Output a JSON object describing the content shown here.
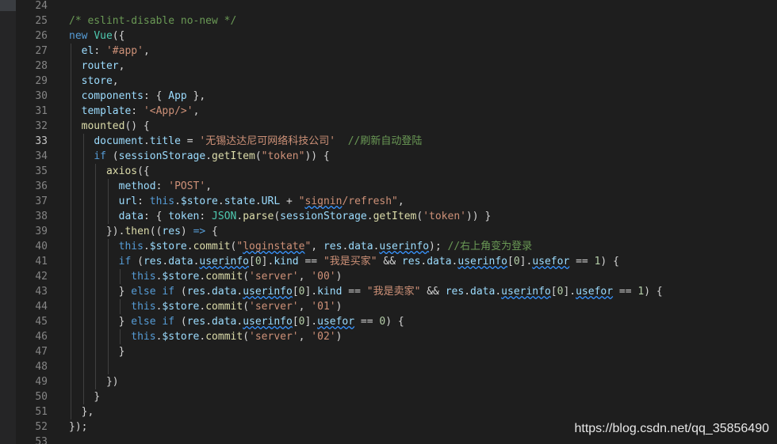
{
  "editor": {
    "lines": [
      {
        "num": "24",
        "tokens": []
      },
      {
        "num": "25",
        "tokens": [
          {
            "t": "/* eslint-disable no-new */",
            "c": "c"
          }
        ]
      },
      {
        "num": "26",
        "tokens": [
          {
            "t": "new ",
            "c": "k"
          },
          {
            "t": "Vue",
            "c": "t"
          },
          {
            "t": "({",
            "c": ""
          }
        ]
      },
      {
        "num": "27",
        "indent": 1,
        "tokens": [
          {
            "t": "el",
            "c": "p"
          },
          {
            "t": ": ",
            "c": ""
          },
          {
            "t": "'#app'",
            "c": "s"
          },
          {
            "t": ",",
            "c": ""
          }
        ]
      },
      {
        "num": "28",
        "indent": 1,
        "tokens": [
          {
            "t": "router",
            "c": "p"
          },
          {
            "t": ",",
            "c": ""
          }
        ]
      },
      {
        "num": "29",
        "indent": 1,
        "tokens": [
          {
            "t": "store",
            "c": "p"
          },
          {
            "t": ",",
            "c": ""
          }
        ]
      },
      {
        "num": "30",
        "indent": 1,
        "tokens": [
          {
            "t": "components",
            "c": "p"
          },
          {
            "t": ": { ",
            "c": ""
          },
          {
            "t": "App",
            "c": "p"
          },
          {
            "t": " },",
            "c": ""
          }
        ]
      },
      {
        "num": "31",
        "indent": 1,
        "tokens": [
          {
            "t": "template",
            "c": "p"
          },
          {
            "t": ": ",
            "c": ""
          },
          {
            "t": "'<App/>'",
            "c": "s"
          },
          {
            "t": ",",
            "c": ""
          }
        ]
      },
      {
        "num": "32",
        "indent": 1,
        "tokens": [
          {
            "t": "mounted",
            "c": "f"
          },
          {
            "t": "() {",
            "c": ""
          }
        ]
      },
      {
        "num": "33",
        "indent": 2,
        "active": true,
        "tokens": [
          {
            "t": "document",
            "c": "p"
          },
          {
            "t": ".",
            "c": ""
          },
          {
            "t": "title",
            "c": "p"
          },
          {
            "t": " = ",
            "c": ""
          },
          {
            "t": "'无锡达达尼可网络科技公司'",
            "c": "s"
          },
          {
            "t": "  ",
            "c": ""
          },
          {
            "t": "//刷新自动登陆",
            "c": "c"
          }
        ]
      },
      {
        "num": "34",
        "indent": 2,
        "tokens": [
          {
            "t": "if",
            "c": "k"
          },
          {
            "t": " (",
            "c": ""
          },
          {
            "t": "sessionStorage",
            "c": "p"
          },
          {
            "t": ".",
            "c": ""
          },
          {
            "t": "getItem",
            "c": "f"
          },
          {
            "t": "(",
            "c": ""
          },
          {
            "t": "\"token\"",
            "c": "s"
          },
          {
            "t": ")) {",
            "c": ""
          }
        ]
      },
      {
        "num": "35",
        "indent": 3,
        "tokens": [
          {
            "t": "axios",
            "c": "f"
          },
          {
            "t": "({",
            "c": ""
          }
        ]
      },
      {
        "num": "36",
        "indent": 4,
        "tokens": [
          {
            "t": "method",
            "c": "p"
          },
          {
            "t": ": ",
            "c": ""
          },
          {
            "t": "'POST'",
            "c": "s"
          },
          {
            "t": ",",
            "c": ""
          }
        ]
      },
      {
        "num": "37",
        "indent": 4,
        "tokens": [
          {
            "t": "url",
            "c": "p"
          },
          {
            "t": ": ",
            "c": ""
          },
          {
            "t": "this",
            "c": "k"
          },
          {
            "t": ".",
            "c": ""
          },
          {
            "t": "$store",
            "c": "p"
          },
          {
            "t": ".",
            "c": ""
          },
          {
            "t": "state",
            "c": "p"
          },
          {
            "t": ".",
            "c": ""
          },
          {
            "t": "URL",
            "c": "p"
          },
          {
            "t": " + ",
            "c": ""
          },
          {
            "t": "\"",
            "c": "s"
          },
          {
            "t": "signin",
            "c": "s",
            "sq": true
          },
          {
            "t": "/refresh\"",
            "c": "s"
          },
          {
            "t": ",",
            "c": ""
          }
        ]
      },
      {
        "num": "38",
        "indent": 4,
        "tokens": [
          {
            "t": "data",
            "c": "p"
          },
          {
            "t": ": { ",
            "c": ""
          },
          {
            "t": "token",
            "c": "p"
          },
          {
            "t": ": ",
            "c": ""
          },
          {
            "t": "JSON",
            "c": "t"
          },
          {
            "t": ".",
            "c": ""
          },
          {
            "t": "parse",
            "c": "f"
          },
          {
            "t": "(",
            "c": ""
          },
          {
            "t": "sessionStorage",
            "c": "p"
          },
          {
            "t": ".",
            "c": ""
          },
          {
            "t": "getItem",
            "c": "f"
          },
          {
            "t": "(",
            "c": ""
          },
          {
            "t": "'token'",
            "c": "s"
          },
          {
            "t": ")) }",
            "c": ""
          }
        ]
      },
      {
        "num": "39",
        "indent": 3,
        "tokens": [
          {
            "t": "}).",
            "c": ""
          },
          {
            "t": "then",
            "c": "f"
          },
          {
            "t": "((",
            "c": ""
          },
          {
            "t": "res",
            "c": "p"
          },
          {
            "t": ") ",
            "c": ""
          },
          {
            "t": "=>",
            "c": "k"
          },
          {
            "t": " {",
            "c": ""
          }
        ]
      },
      {
        "num": "40",
        "indent": 4,
        "tokens": [
          {
            "t": "this",
            "c": "k"
          },
          {
            "t": ".",
            "c": ""
          },
          {
            "t": "$store",
            "c": "p"
          },
          {
            "t": ".",
            "c": ""
          },
          {
            "t": "commit",
            "c": "f"
          },
          {
            "t": "(",
            "c": ""
          },
          {
            "t": "\"",
            "c": "s"
          },
          {
            "t": "loginstate",
            "c": "s",
            "sq": true
          },
          {
            "t": "\"",
            "c": "s"
          },
          {
            "t": ", ",
            "c": ""
          },
          {
            "t": "res",
            "c": "p"
          },
          {
            "t": ".",
            "c": ""
          },
          {
            "t": "data",
            "c": "p"
          },
          {
            "t": ".",
            "c": ""
          },
          {
            "t": "userinfo",
            "c": "p",
            "sq": true
          },
          {
            "t": "); ",
            "c": ""
          },
          {
            "t": "//右上角变为登录",
            "c": "c"
          }
        ]
      },
      {
        "num": "41",
        "indent": 4,
        "tokens": [
          {
            "t": "if",
            "c": "k"
          },
          {
            "t": " (",
            "c": ""
          },
          {
            "t": "res",
            "c": "p"
          },
          {
            "t": ".",
            "c": ""
          },
          {
            "t": "data",
            "c": "p"
          },
          {
            "t": ".",
            "c": ""
          },
          {
            "t": "userinfo",
            "c": "p",
            "sq": true
          },
          {
            "t": "[",
            "c": ""
          },
          {
            "t": "0",
            "c": "n"
          },
          {
            "t": "].",
            "c": ""
          },
          {
            "t": "kind",
            "c": "p"
          },
          {
            "t": " == ",
            "c": ""
          },
          {
            "t": "\"我是买家\"",
            "c": "s"
          },
          {
            "t": " && ",
            "c": ""
          },
          {
            "t": "res",
            "c": "p"
          },
          {
            "t": ".",
            "c": ""
          },
          {
            "t": "data",
            "c": "p"
          },
          {
            "t": ".",
            "c": ""
          },
          {
            "t": "userinfo",
            "c": "p",
            "sq": true
          },
          {
            "t": "[",
            "c": ""
          },
          {
            "t": "0",
            "c": "n"
          },
          {
            "t": "].",
            "c": ""
          },
          {
            "t": "usefor",
            "c": "p",
            "sq": true
          },
          {
            "t": " == ",
            "c": ""
          },
          {
            "t": "1",
            "c": "n"
          },
          {
            "t": ") {",
            "c": ""
          }
        ]
      },
      {
        "num": "42",
        "indent": 5,
        "tokens": [
          {
            "t": "this",
            "c": "k"
          },
          {
            "t": ".",
            "c": ""
          },
          {
            "t": "$store",
            "c": "p"
          },
          {
            "t": ".",
            "c": ""
          },
          {
            "t": "commit",
            "c": "f"
          },
          {
            "t": "(",
            "c": ""
          },
          {
            "t": "'server'",
            "c": "s"
          },
          {
            "t": ", ",
            "c": ""
          },
          {
            "t": "'00'",
            "c": "s"
          },
          {
            "t": ")",
            "c": ""
          }
        ]
      },
      {
        "num": "43",
        "indent": 4,
        "tokens": [
          {
            "t": "} ",
            "c": ""
          },
          {
            "t": "else if",
            "c": "k"
          },
          {
            "t": " (",
            "c": ""
          },
          {
            "t": "res",
            "c": "p"
          },
          {
            "t": ".",
            "c": ""
          },
          {
            "t": "data",
            "c": "p"
          },
          {
            "t": ".",
            "c": ""
          },
          {
            "t": "userinfo",
            "c": "p",
            "sq": true
          },
          {
            "t": "[",
            "c": ""
          },
          {
            "t": "0",
            "c": "n"
          },
          {
            "t": "].",
            "c": ""
          },
          {
            "t": "kind",
            "c": "p"
          },
          {
            "t": " == ",
            "c": ""
          },
          {
            "t": "\"我是卖家\"",
            "c": "s"
          },
          {
            "t": " && ",
            "c": ""
          },
          {
            "t": "res",
            "c": "p"
          },
          {
            "t": ".",
            "c": ""
          },
          {
            "t": "data",
            "c": "p"
          },
          {
            "t": ".",
            "c": ""
          },
          {
            "t": "userinfo",
            "c": "p",
            "sq": true
          },
          {
            "t": "[",
            "c": ""
          },
          {
            "t": "0",
            "c": "n"
          },
          {
            "t": "].",
            "c": ""
          },
          {
            "t": "usefor",
            "c": "p",
            "sq": true
          },
          {
            "t": " == ",
            "c": ""
          },
          {
            "t": "1",
            "c": "n"
          },
          {
            "t": ") {",
            "c": ""
          }
        ]
      },
      {
        "num": "44",
        "indent": 5,
        "tokens": [
          {
            "t": "this",
            "c": "k"
          },
          {
            "t": ".",
            "c": ""
          },
          {
            "t": "$store",
            "c": "p"
          },
          {
            "t": ".",
            "c": ""
          },
          {
            "t": "commit",
            "c": "f"
          },
          {
            "t": "(",
            "c": ""
          },
          {
            "t": "'server'",
            "c": "s"
          },
          {
            "t": ", ",
            "c": ""
          },
          {
            "t": "'01'",
            "c": "s"
          },
          {
            "t": ")",
            "c": ""
          }
        ]
      },
      {
        "num": "45",
        "indent": 4,
        "tokens": [
          {
            "t": "} ",
            "c": ""
          },
          {
            "t": "else if",
            "c": "k"
          },
          {
            "t": " (",
            "c": ""
          },
          {
            "t": "res",
            "c": "p"
          },
          {
            "t": ".",
            "c": ""
          },
          {
            "t": "data",
            "c": "p"
          },
          {
            "t": ".",
            "c": ""
          },
          {
            "t": "userinfo",
            "c": "p",
            "sq": true
          },
          {
            "t": "[",
            "c": ""
          },
          {
            "t": "0",
            "c": "n"
          },
          {
            "t": "].",
            "c": ""
          },
          {
            "t": "usefor",
            "c": "p",
            "sq": true
          },
          {
            "t": " == ",
            "c": ""
          },
          {
            "t": "0",
            "c": "n"
          },
          {
            "t": ") {",
            "c": ""
          }
        ]
      },
      {
        "num": "46",
        "indent": 5,
        "tokens": [
          {
            "t": "this",
            "c": "k"
          },
          {
            "t": ".",
            "c": ""
          },
          {
            "t": "$store",
            "c": "p"
          },
          {
            "t": ".",
            "c": ""
          },
          {
            "t": "commit",
            "c": "f"
          },
          {
            "t": "(",
            "c": ""
          },
          {
            "t": "'server'",
            "c": "s"
          },
          {
            "t": ", ",
            "c": ""
          },
          {
            "t": "'02'",
            "c": "s"
          },
          {
            "t": ")",
            "c": ""
          }
        ]
      },
      {
        "num": "47",
        "indent": 4,
        "tokens": [
          {
            "t": "}",
            "c": ""
          }
        ]
      },
      {
        "num": "48",
        "indent": 4,
        "tokens": []
      },
      {
        "num": "49",
        "indent": 3,
        "tokens": [
          {
            "t": "})",
            "c": ""
          }
        ]
      },
      {
        "num": "50",
        "indent": 2,
        "tokens": [
          {
            "t": "}",
            "c": ""
          }
        ]
      },
      {
        "num": "51",
        "indent": 1,
        "tokens": [
          {
            "t": "},",
            "c": ""
          }
        ]
      },
      {
        "num": "52",
        "tokens": [
          {
            "t": "});",
            "c": ""
          }
        ]
      },
      {
        "num": "53",
        "tokens": []
      }
    ]
  },
  "watermark": "https://blog.csdn.net/qq_35856490",
  "colors": {
    "background": "#1e1e1e",
    "keyword": "#569cd6",
    "string": "#ce9178",
    "property": "#9cdcfe",
    "function": "#dcdcaa",
    "comment": "#6a9955",
    "number": "#b5cea8",
    "type": "#4ec9b0"
  }
}
